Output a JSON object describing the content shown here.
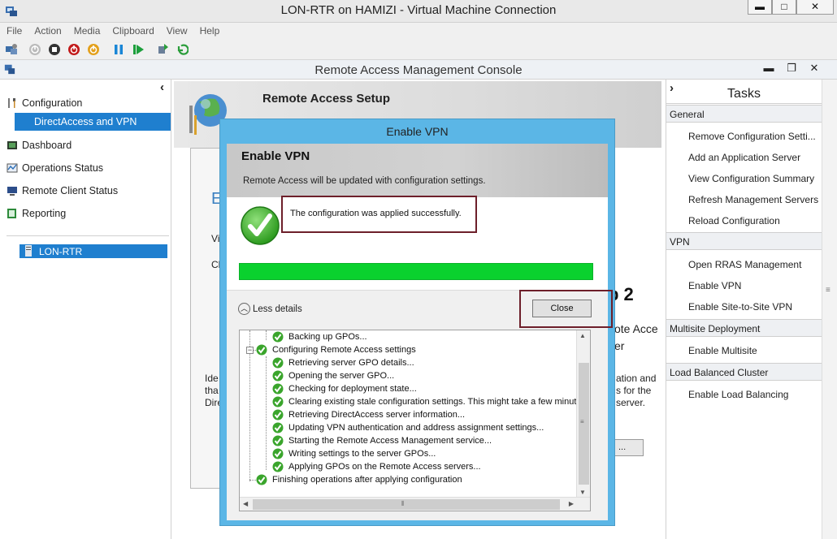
{
  "vm_window": {
    "title": "LON-RTR on HAMIZI - Virtual Machine Connection",
    "controls": {
      "minimize": "▬",
      "maximize": "□",
      "close": "✕"
    },
    "menu": [
      "File",
      "Action",
      "Media",
      "Clipboard",
      "View",
      "Help"
    ],
    "toolbar_icons": [
      "ctrl-alt-del-icon",
      "start-icon",
      "turn-off-icon",
      "shut-down-icon",
      "save-icon",
      "pause-icon",
      "reset-icon",
      "checkpoint-icon",
      "revert-icon"
    ]
  },
  "console": {
    "title": "Remote Access Management Console",
    "controls": {
      "minimize": "▬",
      "restore": "❐",
      "close": "✕"
    }
  },
  "nav": {
    "collapse_glyph": "‹",
    "items": [
      {
        "label": "Configuration",
        "icon": "tools-icon"
      },
      {
        "label": "DirectAccess and VPN",
        "selected": true
      },
      {
        "label": "Dashboard",
        "icon": "dashboard-icon"
      },
      {
        "label": "Operations Status",
        "icon": "operations-icon"
      },
      {
        "label": "Remote Client Status",
        "icon": "monitor-icon"
      },
      {
        "label": "Reporting",
        "icon": "report-icon"
      }
    ],
    "server": "LON-RTR"
  },
  "setup": {
    "title": "Remote Access Setup",
    "fragments": {
      "e": "E",
      "vi": "Vi",
      "cl": "Cl",
      "step": "p 2",
      "rote": "ote Acce",
      "er": "er",
      "ide": "Ide",
      "tha": "tha",
      "dire": "Dire",
      "ation": "ation and",
      "sfor": "s for the",
      "server": "server.",
      "ellipsis": "..."
    }
  },
  "tasks": {
    "title": "Tasks",
    "expand_glyph": "›",
    "sections": [
      {
        "name": "General",
        "links": [
          "Remove Configuration Setti...",
          "Add an Application Server",
          "View Configuration Summary",
          "Refresh Management Servers",
          "Reload Configuration"
        ]
      },
      {
        "name": "VPN",
        "links": [
          "Open RRAS Management",
          "Enable VPN",
          "Enable Site-to-Site VPN"
        ]
      },
      {
        "name": "Multisite Deployment",
        "links": [
          "Enable Multisite"
        ]
      },
      {
        "name": "Load Balanced Cluster",
        "links": [
          "Enable Load Balancing"
        ]
      }
    ]
  },
  "dialog": {
    "title": "Enable VPN",
    "heading": "Enable VPN",
    "subheading": "Remote Access will be updated with configuration settings.",
    "status": "The configuration was applied successfully.",
    "progress": 1.0,
    "less_details": "Less details",
    "less_details_glyph": "︿",
    "close_label": "Close",
    "tree": [
      {
        "label": "Backing up GPOs...",
        "level": 1
      },
      {
        "label": "Configuring Remote Access settings",
        "level": 0,
        "expander": "−"
      },
      {
        "label": "Retrieving server GPO details...",
        "level": 1
      },
      {
        "label": "Opening the server GPO...",
        "level": 1
      },
      {
        "label": "Checking for deployment state...",
        "level": 1
      },
      {
        "label": "Clearing existing stale configuration settings. This might take a few minutes.",
        "level": 1
      },
      {
        "label": "Retrieving DirectAccess server information...",
        "level": 1
      },
      {
        "label": "Updating VPN authentication and address assignment settings...",
        "level": 1
      },
      {
        "label": "Starting the Remote Access Management service...",
        "level": 1
      },
      {
        "label": "Writing settings to the server GPOs...",
        "level": 1
      },
      {
        "label": "Applying GPOs on the Remote Access servers...",
        "level": 1
      },
      {
        "label": "Finishing operations after applying configuration",
        "level": 0
      }
    ],
    "scroll_glyphs": {
      "up": "▲",
      "down": "▼",
      "left": "◀",
      "right": "▶",
      "grip_v": "≡",
      "grip_h": "⦀"
    }
  },
  "colors": {
    "selection": "#1f7fcf",
    "dialog_frame": "#5bb6e6",
    "progress": "#0ad12e",
    "highlight_box": "#6d1f2a"
  }
}
